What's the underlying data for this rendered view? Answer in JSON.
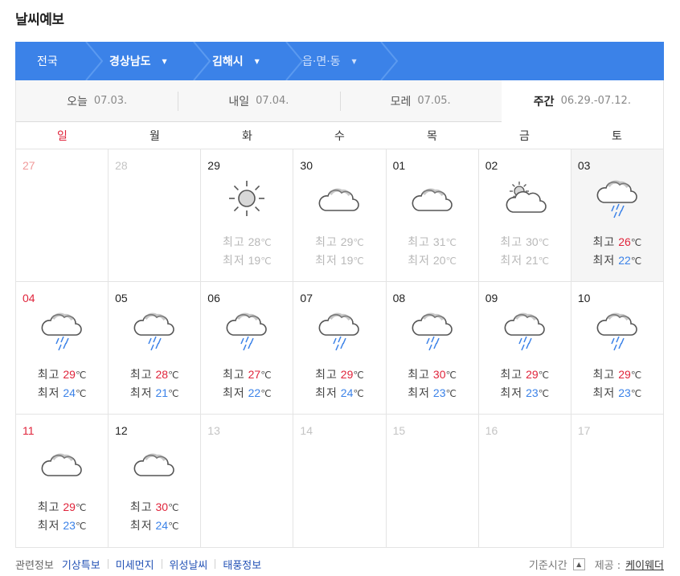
{
  "page_title": "날씨예보",
  "breadcrumb": [
    {
      "label": "전국",
      "bold": false,
      "dropdown": false
    },
    {
      "label": "경상남도",
      "bold": true,
      "dropdown": true
    },
    {
      "label": "김해시",
      "bold": true,
      "dropdown": true
    },
    {
      "label": "읍·면·동",
      "bold": false,
      "dropdown": true
    }
  ],
  "tabs": [
    {
      "label": "오늘",
      "date": "07.03.",
      "active": false
    },
    {
      "label": "내일",
      "date": "07.04.",
      "active": false
    },
    {
      "label": "모레",
      "date": "07.05.",
      "active": false
    },
    {
      "label": "주간",
      "date": "06.29.-07.12.",
      "active": true
    }
  ],
  "weekdays": [
    "일",
    "월",
    "화",
    "수",
    "목",
    "금",
    "토"
  ],
  "temp_labels": {
    "high": "최고",
    "low": "최저",
    "unit": "℃"
  },
  "weeks": [
    [
      {
        "day": "27",
        "faded": true,
        "icon": null
      },
      {
        "day": "28",
        "faded": true,
        "icon": null
      },
      {
        "day": "29",
        "icon": "sunny-icon",
        "high": "28",
        "low": "19",
        "past": true
      },
      {
        "day": "30",
        "icon": "cloudy-icon",
        "high": "29",
        "low": "19",
        "past": true
      },
      {
        "day": "01",
        "icon": "cloudy-icon",
        "high": "31",
        "low": "20",
        "past": true
      },
      {
        "day": "02",
        "icon": "partly-cloudy-icon",
        "high": "30",
        "low": "21",
        "past": true
      },
      {
        "day": "03",
        "icon": "rain-icon",
        "high": "26",
        "low": "22",
        "today": true
      }
    ],
    [
      {
        "day": "04",
        "icon": "rain-icon",
        "high": "29",
        "low": "24"
      },
      {
        "day": "05",
        "icon": "rain-icon",
        "high": "28",
        "low": "21"
      },
      {
        "day": "06",
        "icon": "rain-icon",
        "high": "27",
        "low": "22"
      },
      {
        "day": "07",
        "icon": "rain-icon",
        "high": "29",
        "low": "24"
      },
      {
        "day": "08",
        "icon": "rain-icon",
        "high": "30",
        "low": "23"
      },
      {
        "day": "09",
        "icon": "rain-icon",
        "high": "29",
        "low": "23"
      },
      {
        "day": "10",
        "icon": "rain-icon",
        "high": "29",
        "low": "23"
      }
    ],
    [
      {
        "day": "11",
        "icon": "cloudy-icon",
        "high": "29",
        "low": "23"
      },
      {
        "day": "12",
        "icon": "cloudy-icon",
        "high": "30",
        "low": "24"
      },
      {
        "day": "13",
        "faded": true,
        "icon": null
      },
      {
        "day": "14",
        "faded": true,
        "icon": null
      },
      {
        "day": "15",
        "faded": true,
        "icon": null
      },
      {
        "day": "16",
        "faded": true,
        "icon": null
      },
      {
        "day": "17",
        "faded": true,
        "icon": null
      }
    ]
  ],
  "footer": {
    "related_label": "관련정보",
    "links": [
      "기상특보",
      "미세먼지",
      "위성날씨",
      "태풍정보"
    ],
    "base_time_label": "기준시간",
    "provider_label": "제공 :",
    "provider_name": "케이웨더"
  },
  "colors": {
    "accent": "#3b82e8",
    "high_temp": "#e0243b",
    "low_temp": "#3b82e8",
    "sunday": "#e0243b"
  }
}
